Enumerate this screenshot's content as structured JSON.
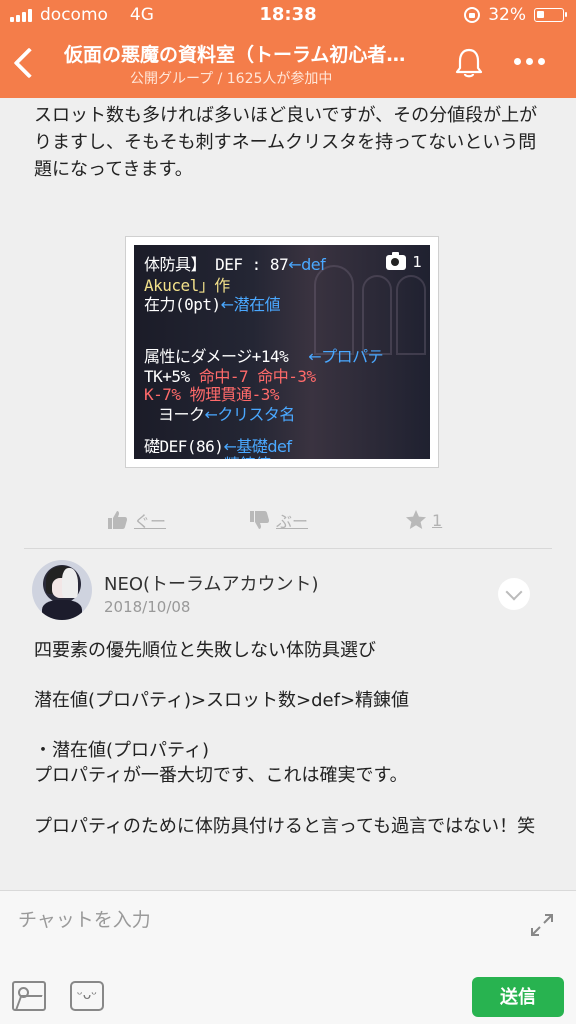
{
  "status": {
    "carrier": "docomo",
    "network": "4G",
    "time": "18:38",
    "battery": "32%",
    "battery_level": 0.32
  },
  "header": {
    "title": "仮面の悪魔の資料室（トーラム初心者…",
    "subtitle": "公開グループ / 1625人が参加中"
  },
  "post": {
    "text": "スロット数も多ければ多いほど良いですが、その分値段が上がりますし、そもそも刺すネームクリスタを持ってないという問題になってきます。",
    "image": {
      "photo_count": "1",
      "lines": {
        "l1": "体防具】 DEF : 87",
        "l1_note": "←def",
        "l2": "Akucel」作",
        "l3": "在力(0pt)",
        "l3_note": "←潜在値",
        "l4": "属性にダメージ+14%",
        "l4_note": "←プロパテ",
        "l5a": "TK+5%",
        "l5b": "命中-7  命中-3%",
        "l6": "K-7%  物理貫通-3%",
        "l7": "ヨーク",
        "l7_note": "←クリスタ名",
        "l8": "礎DEF(86)",
        "l8_note": "←基礎def",
        "l9": "精錬値"
      }
    },
    "reactions": {
      "good": "ぐー",
      "bad": "ぶー",
      "star_count": "1"
    }
  },
  "comment": {
    "author": "NEO(トーラムアカウント)",
    "date": "2018/10/08",
    "paragraphs": [
      "四要素の優先順位と失敗しない体防具選び",
      "潜在値(プロパティ)>スロット数>def>精錬値",
      "・潜在値(プロパティ)",
      "プロパティが一番大切です、これは確実です。",
      "プロパティのために体防具付けると言っても過言ではない！笑"
    ]
  },
  "chat": {
    "placeholder": "チャットを入力",
    "send_label": "送信"
  },
  "colors": {
    "accent": "#f47d4a",
    "send": "#28b350"
  }
}
